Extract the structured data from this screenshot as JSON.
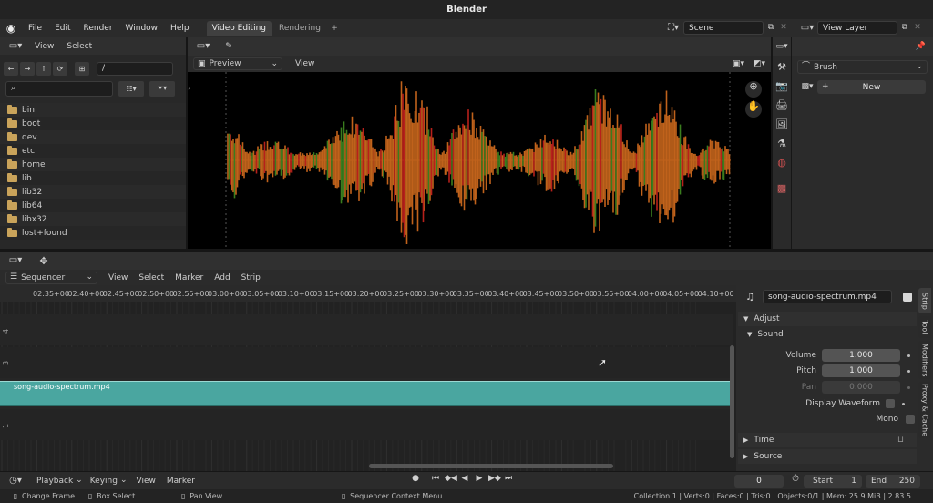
{
  "window": {
    "title": "Blender"
  },
  "topbar": {
    "menus": [
      "File",
      "Edit",
      "Render",
      "Window",
      "Help"
    ],
    "tabs": [
      {
        "label": "Video Editing",
        "active": true
      },
      {
        "label": "Rendering",
        "active": false
      }
    ],
    "add_tab": "+",
    "scene": "Scene",
    "view_layer": "View Layer"
  },
  "file_browser": {
    "menus": [
      "View",
      "Select"
    ],
    "path": "/",
    "search_placeholder": "",
    "items": [
      "bin",
      "boot",
      "dev",
      "etc",
      "home",
      "lib",
      "lib32",
      "lib64",
      "libx32",
      "lost+found"
    ]
  },
  "preview": {
    "mode": "Preview",
    "view_menu": "View"
  },
  "brush_panel": {
    "brush_label": "Brush",
    "new_label": "New"
  },
  "sequencer": {
    "editor": "Sequencer",
    "menus": [
      "View",
      "Select",
      "Marker",
      "Add",
      "Strip"
    ],
    "timecodes": [
      "02:35+00",
      "02:40+00",
      "02:45+00",
      "02:50+00",
      "02:55+00",
      "03:00+00",
      "03:05+00",
      "03:10+00",
      "03:15+00",
      "03:20+00",
      "03:25+00",
      "03:30+00",
      "03:35+00",
      "03:40+00",
      "03:45+00",
      "03:50+00",
      "03:55+00",
      "04:00+00",
      "04:05+00",
      "04:10+00"
    ],
    "channels": [
      "4",
      "3",
      "2",
      "1"
    ],
    "strip": {
      "name": "song-audio-spectrum.mp4",
      "color": "#4aa6a0"
    }
  },
  "strip_props": {
    "name": "song-audio-spectrum.mp4",
    "adjust": "Adjust",
    "sound": "Sound",
    "volume_label": "Volume",
    "volume": "1.000",
    "pitch_label": "Pitch",
    "pitch": "1.000",
    "pan_label": "Pan",
    "pan": "0.000",
    "display_waveform": "Display Waveform",
    "mono": "Mono",
    "time": "Time",
    "source": "Source",
    "side_tabs": [
      "Strip",
      "Tool",
      "Modifiers",
      "Proxy & Cache"
    ]
  },
  "timeline": {
    "menus": [
      "Playback",
      "Keying",
      "View",
      "Marker"
    ],
    "current_frame": "0",
    "start_label": "Start",
    "start": "1",
    "end_label": "End",
    "end": "250"
  },
  "statusbar": {
    "hints": [
      "Change Frame",
      "Box Select",
      "Pan View",
      "Sequencer Context Menu"
    ],
    "stats": "Collection 1 | Verts:0 | Faces:0 | Tris:0 | Objects:0/1 | Mem: 25.9 MiB | 2.83.5"
  },
  "colors": {
    "accent": "#4aa6a0",
    "spectrum_orange": "#c0621b",
    "spectrum_red": "#b8201b",
    "spectrum_green": "#3a7d1e"
  }
}
